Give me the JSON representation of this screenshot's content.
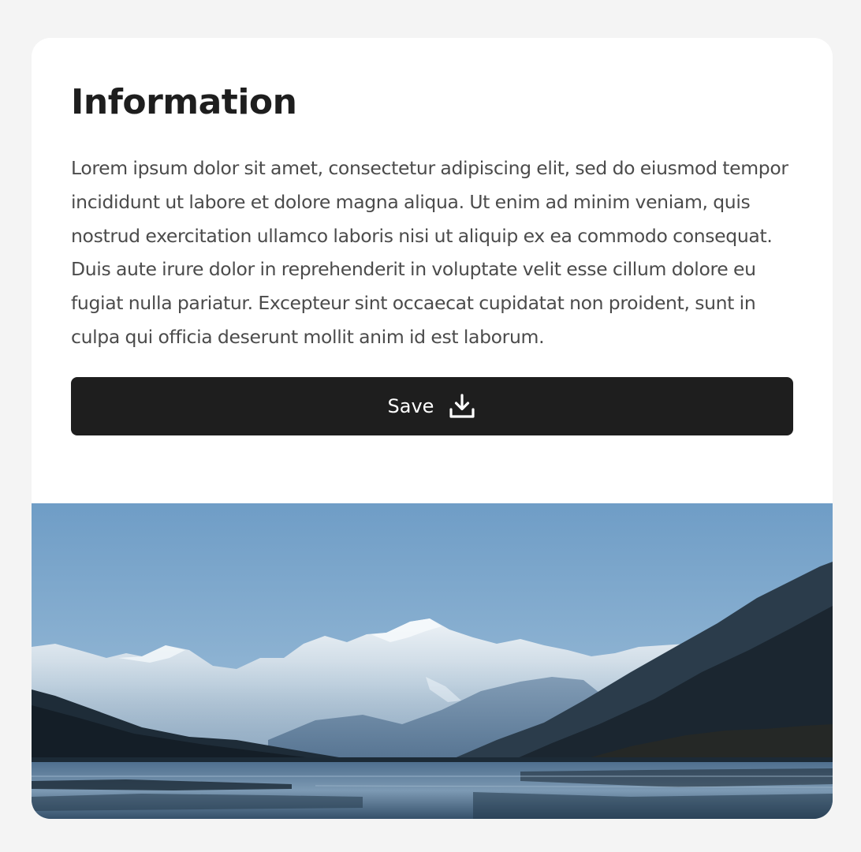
{
  "card": {
    "title": "Information",
    "body": "Lorem ipsum dolor sit amet, consectetur adipiscing elit, sed do eiusmod tempor incididunt ut labore et dolore magna aliqua. Ut enim ad minim veniam, quis nostrud exercitation ullamco laboris nisi ut aliquip ex ea commodo consequat. Duis aute irure dolor in reprehenderit in voluptate velit esse cillum dolore eu fugiat nulla pariatur. Excepteur sint occaecat cupidatat non proident, sunt in culpa qui officia deserunt mollit anim id est laborum.",
    "save_button": {
      "label": "Save",
      "icon": "download-icon"
    },
    "image": {
      "subject": "mountain-lake-landscape"
    }
  },
  "colors": {
    "page_background": "#f4f4f4",
    "card_background": "#ffffff",
    "title": "#1e1e1e",
    "body_text": "#4b4b4b",
    "button_background": "#1e1e1e",
    "button_text": "#ffffff"
  }
}
